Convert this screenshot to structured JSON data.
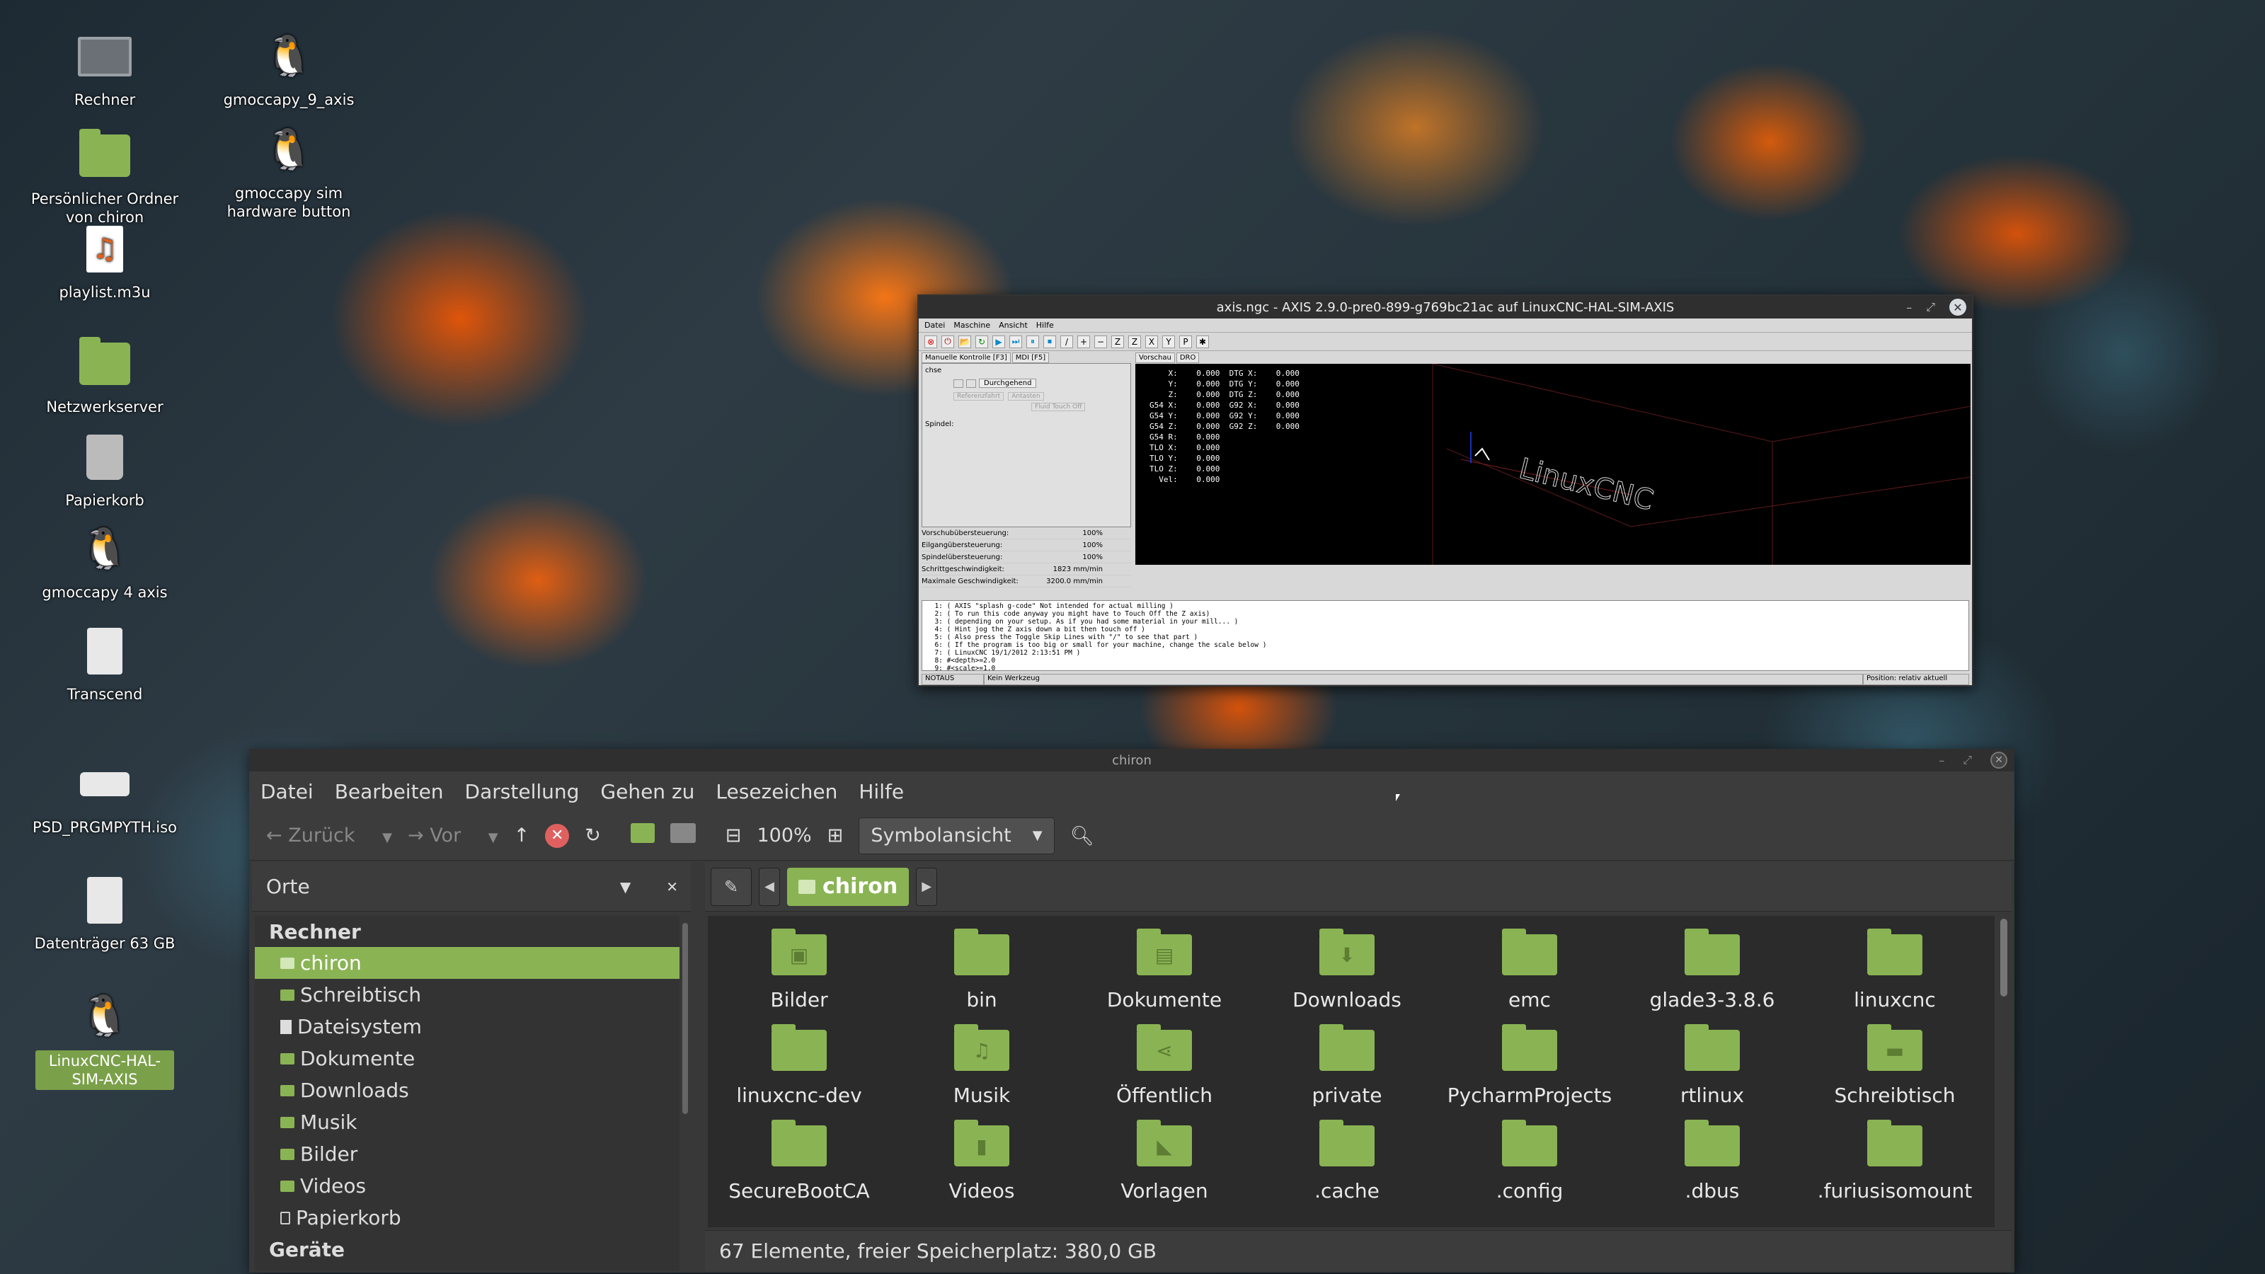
{
  "desktop": {
    "icons": [
      {
        "label": "Rechner",
        "icon": "computer-icon"
      },
      {
        "label": "Persönlicher Ordner von chiron",
        "icon": "home-folder-icon"
      },
      {
        "label": "playlist.m3u",
        "icon": "playlist-icon"
      },
      {
        "label": "Netzwerkserver",
        "icon": "network-folder-icon"
      },
      {
        "label": "Papierkorb",
        "icon": "trash-icon"
      },
      {
        "label": "gmoccapy 4 axis",
        "icon": "penguin-icon"
      },
      {
        "label": "Transcend",
        "icon": "drive-icon"
      },
      {
        "label": "PSD_PRGMPYTH.iso",
        "icon": "disc-image-icon"
      },
      {
        "label": "Datenträger 63 GB",
        "icon": "drive-icon"
      },
      {
        "label": "LinuxCNC-HAL-SIM-AXIS",
        "icon": "penguin-icon"
      },
      {
        "label": "gmoccapy_9_axis",
        "icon": "penguin-icon"
      },
      {
        "label": "gmoccapy sim hardware button",
        "icon": "penguin-icon"
      }
    ]
  },
  "axis": {
    "title": "axis.ngc - AXIS 2.9.0-pre0-899-g769bc21ac auf  LinuxCNC-HAL-SIM-AXIS",
    "menu": [
      "Datei",
      "Maschine",
      "Ansicht",
      "Hilfe"
    ],
    "tabs_left": [
      "Manuelle Kontrolle [F3]",
      "MDI [F5]"
    ],
    "tabs_right": [
      "Vorschau",
      "DRO"
    ],
    "panel_achse": "chse",
    "panel_mode": "Durchgehend",
    "panel_spindel": "Spindel:",
    "panel_btn1": "Referenzfahrt",
    "panel_btn2": "Antasten",
    "panel_btn3": "Fluid Touch Off",
    "sliders": [
      {
        "label": "Vorschubübersteuerung:",
        "value": "100%"
      },
      {
        "label": "Eilgangübersteuerung:",
        "value": "100%"
      },
      {
        "label": "Spindelübersteuerung:",
        "value": "100%"
      },
      {
        "label": "Schrittgeschwindigkeit:",
        "value": "1823 mm/min"
      },
      {
        "label": "Maximale Geschwindigkeit:",
        "value": "3200.0 mm/min"
      }
    ],
    "dro": "    X:    0.000  DTG X:    0.000\n    Y:    0.000  DTG Y:    0.000\n    Z:    0.000  DTG Z:    0.000\nG54 X:    0.000  G92 X:    0.000\nG54 Y:    0.000  G92 Y:    0.000\nG54 Z:    0.000  G92 Z:    0.000\nG54 R:    0.000\nTLO X:    0.000\nTLO Y:    0.000\nTLO Z:    0.000\n  Vel:    0.000",
    "preview_text": "LinuxCNC",
    "code": "  1: ( AXIS \"splash g-code\" Not intended for actual milling )\n  2: ( To run this code anyway you might have to Touch Off the Z axis)\n  3: ( depending on your setup. As if you had some material in your mill... )\n  4: ( Hint jog the Z axis down a bit then touch off )\n  5: ( Also press the Toggle Skip Lines with \"/\" to see that part )\n  6: ( If the program is too big or small for your machine, change the scale below )\n  7: ( LinuxCNC 19/1/2012 2:13:51 PM )\n  8: #<depth>=2.0\n  9: #<scale>=1.0",
    "status_left": "NOTAUS",
    "status_mid": "Kein Werkzeug",
    "status_right": "Position: relativ aktuell"
  },
  "fm": {
    "title": "chiron",
    "menu": [
      "Datei",
      "Bearbeiten",
      "Darstellung",
      "Gehen zu",
      "Lesezeichen",
      "Hilfe"
    ],
    "back": "Zurück",
    "forward": "Vor",
    "zoom": "100%",
    "view_mode": "Symbolansicht",
    "places_label": "Orte",
    "sidebar": {
      "cat1": "Rechner",
      "items": [
        "chiron",
        "Schreibtisch",
        "Dateisystem",
        "Dokumente",
        "Downloads",
        "Musik",
        "Bilder",
        "Videos",
        "Papierkorb"
      ],
      "cat2": "Geräte"
    },
    "crumb": "chiron",
    "files": [
      {
        "name": "Bilder",
        "glyph": "▣"
      },
      {
        "name": "bin",
        "glyph": ""
      },
      {
        "name": "Dokumente",
        "glyph": "▤"
      },
      {
        "name": "Downloads",
        "glyph": "⬇"
      },
      {
        "name": "emc",
        "glyph": ""
      },
      {
        "name": "glade3-3.8.6",
        "glyph": ""
      },
      {
        "name": "linuxcnc",
        "glyph": ""
      },
      {
        "name": "linuxcnc-dev",
        "glyph": ""
      },
      {
        "name": "Musik",
        "glyph": "♫"
      },
      {
        "name": "Öffentlich",
        "glyph": "⋖"
      },
      {
        "name": "private",
        "glyph": ""
      },
      {
        "name": "PycharmProjects",
        "glyph": ""
      },
      {
        "name": "rtlinux",
        "glyph": ""
      },
      {
        "name": "Schreibtisch",
        "glyph": "▬"
      },
      {
        "name": "SecureBootCA",
        "glyph": ""
      },
      {
        "name": "Videos",
        "glyph": "▮"
      },
      {
        "name": "Vorlagen",
        "glyph": "◣"
      },
      {
        "name": ".cache",
        "glyph": ""
      },
      {
        "name": ".config",
        "glyph": ""
      },
      {
        "name": ".dbus",
        "glyph": ""
      },
      {
        "name": ".furiusisomount",
        "glyph": ""
      }
    ],
    "status": "67 Elemente, freier Speicherplatz: 380,0 GB"
  }
}
